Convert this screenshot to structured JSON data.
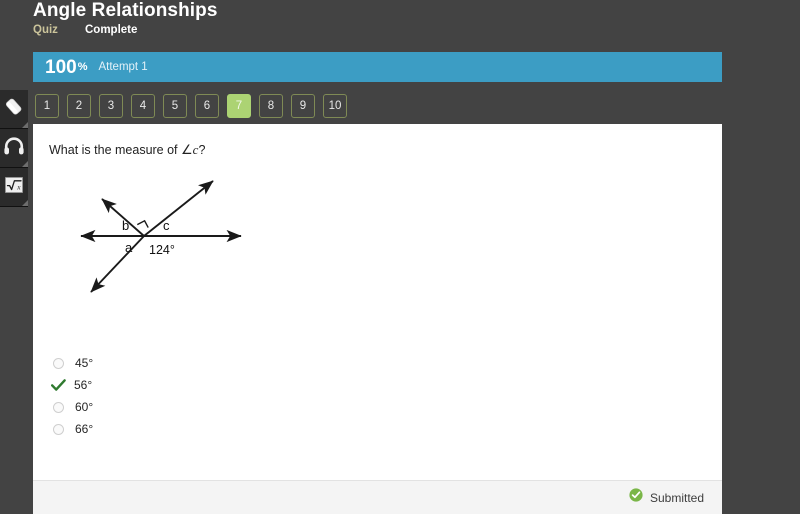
{
  "header": {
    "title": "Angle Relationships",
    "kind": "Quiz",
    "status": "Complete"
  },
  "score": {
    "value": "100",
    "percent_symbol": "%",
    "attempt": "Attempt 1",
    "bar_color": "#3c9dc4"
  },
  "pager": {
    "buttons": [
      "1",
      "2",
      "3",
      "4",
      "5",
      "6",
      "7",
      "8",
      "9",
      "10"
    ],
    "active": "7",
    "active_color": "#acd373"
  },
  "tools": [
    {
      "name": "eraser-tool",
      "icon": "eraser-icon"
    },
    {
      "name": "headphones-tool",
      "icon": "headphones-icon"
    },
    {
      "name": "calculator-tool",
      "icon": "square-root-icon"
    }
  ],
  "question": {
    "prefix": "What is the measure of ",
    "angle_symbol": "∠",
    "variable": "c",
    "suffix": "?"
  },
  "figure": {
    "label_a": "a",
    "label_b": "b",
    "label_c": "c",
    "label_angle": "124°",
    "right_angle_mark": true
  },
  "options": [
    {
      "label": "45°",
      "selected": false
    },
    {
      "label": "56°",
      "selected": true
    },
    {
      "label": "60°",
      "selected": false
    },
    {
      "label": "66°",
      "selected": false
    }
  ],
  "footer": {
    "status_label": "Submitted",
    "status_color": "#7ab648"
  }
}
